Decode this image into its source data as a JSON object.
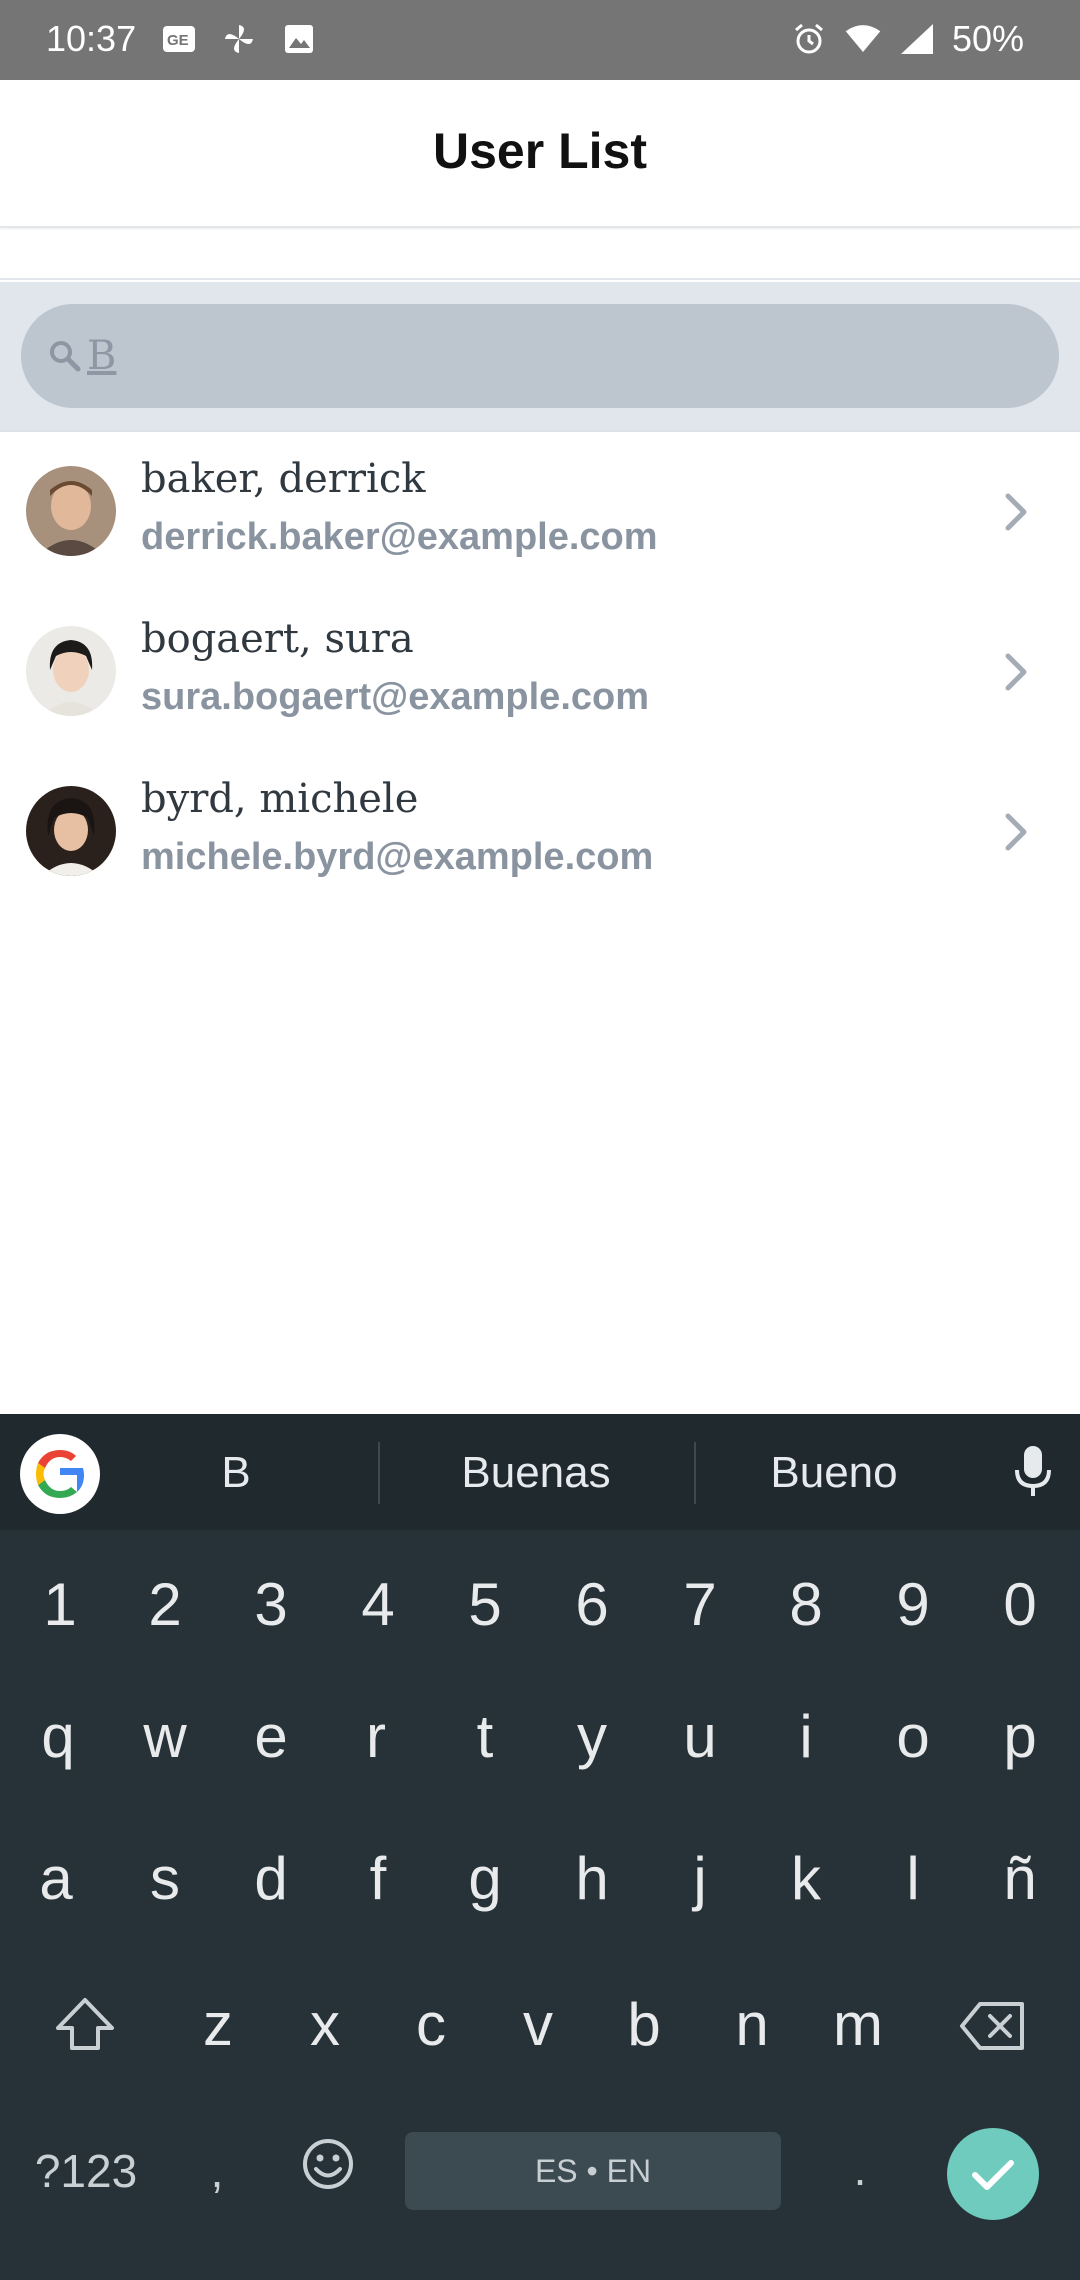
{
  "status_bar": {
    "time": "10:37",
    "battery": "50%",
    "left_icons": [
      "gmail-style-icon",
      "pinwheel-icon",
      "image-icon"
    ],
    "right_icons": [
      "alarm-icon",
      "wifi-icon",
      "signal-icon"
    ]
  },
  "header": {
    "title": "User List"
  },
  "search": {
    "value": "B",
    "placeholder": ""
  },
  "users": [
    {
      "name": "baker, derrick",
      "email": "derrick.baker@example.com"
    },
    {
      "name": "bogaert, sura",
      "email": "sura.bogaert@example.com"
    },
    {
      "name": "byrd, michele",
      "email": "michele.byrd@example.com"
    }
  ],
  "keyboard": {
    "suggestions": [
      "B",
      "Buenas",
      "Bueno"
    ],
    "row_numbers": [
      "1",
      "2",
      "3",
      "4",
      "5",
      "6",
      "7",
      "8",
      "9",
      "0"
    ],
    "row_1": [
      "q",
      "w",
      "e",
      "r",
      "t",
      "y",
      "u",
      "i",
      "o",
      "p"
    ],
    "row_2": [
      "a",
      "s",
      "d",
      "f",
      "g",
      "h",
      "j",
      "k",
      "l",
      "ñ"
    ],
    "row_3": [
      "z",
      "x",
      "c",
      "v",
      "b",
      "n",
      "m"
    ],
    "symbols_label": "?123",
    "comma": ",",
    "space_label": "ES • EN",
    "period": ".",
    "colors": {
      "background": "#263238",
      "accent": "#6fcbbd"
    }
  }
}
